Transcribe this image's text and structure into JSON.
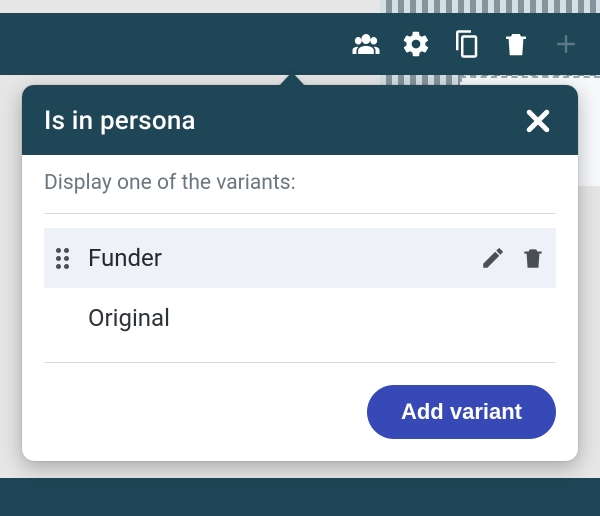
{
  "toolbar": {
    "icons": [
      "people",
      "gear",
      "copy",
      "trash",
      "plus"
    ]
  },
  "popover": {
    "title": "Is in persona",
    "instruction": "Display one of the variants:",
    "variants": [
      {
        "name": "Funder",
        "selected": true,
        "editable": true
      },
      {
        "name": "Original",
        "selected": false,
        "editable": false
      }
    ],
    "add_label": "Add variant"
  }
}
